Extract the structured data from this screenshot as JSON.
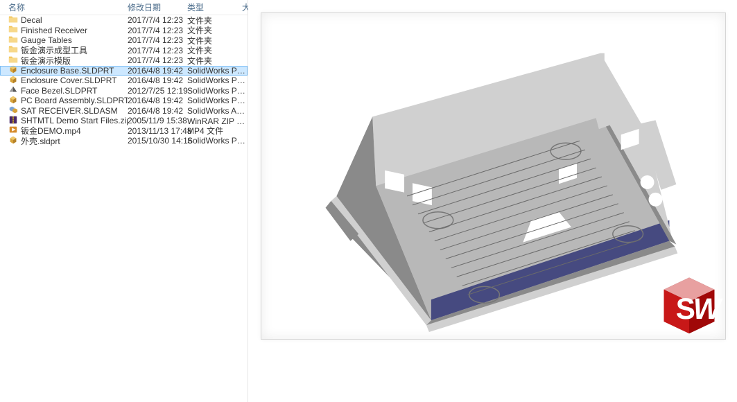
{
  "headers": {
    "name": "名称",
    "date": "修改日期",
    "type": "类型",
    "extra": "大"
  },
  "files": [
    {
      "icon": "folder",
      "name": "Decal",
      "date": "2017/7/4 12:23",
      "type": "文件夹",
      "selected": false
    },
    {
      "icon": "folder",
      "name": "Finished Receiver",
      "date": "2017/7/4 12:23",
      "type": "文件夹",
      "selected": false
    },
    {
      "icon": "folder",
      "name": "Gauge Tables",
      "date": "2017/7/4 12:23",
      "type": "文件夹",
      "selected": false
    },
    {
      "icon": "folder",
      "name": "钣金演示成型工具",
      "date": "2017/7/4 12:23",
      "type": "文件夹",
      "selected": false
    },
    {
      "icon": "folder",
      "name": "钣金演示模版",
      "date": "2017/7/4 12:23",
      "type": "文件夹",
      "selected": false
    },
    {
      "icon": "sldprt",
      "name": "Enclosure Base.SLDPRT",
      "date": "2016/4/8 19:42",
      "type": "SolidWorks Part...",
      "selected": true
    },
    {
      "icon": "sldprt",
      "name": "Enclosure Cover.SLDPRT",
      "date": "2016/4/8 19:42",
      "type": "SolidWorks Part...",
      "selected": false
    },
    {
      "icon": "sldprt-alt",
      "name": "Face Bezel.SLDPRT",
      "date": "2012/7/25 12:19",
      "type": "SolidWorks Part...",
      "selected": false
    },
    {
      "icon": "sldprt",
      "name": "PC Board Assembly.SLDPRT",
      "date": "2016/4/8 19:42",
      "type": "SolidWorks Part...",
      "selected": false
    },
    {
      "icon": "sldasm",
      "name": "SAT RECEIVER.SLDASM",
      "date": "2016/4/8 19:42",
      "type": "SolidWorks Ass...",
      "selected": false
    },
    {
      "icon": "zip",
      "name": "SHTMTL Demo Start Files.zip",
      "date": "2005/11/9 15:38",
      "type": "WinRAR ZIP 压缩...",
      "selected": false
    },
    {
      "icon": "mp4",
      "name": "钣金DEMO.mp4",
      "date": "2013/11/13 17:48",
      "type": "MP4 文件",
      "selected": false
    },
    {
      "icon": "sldprt",
      "name": "外壳.sldprt",
      "date": "2015/10/30 14:16",
      "type": "SolidWorks Part...",
      "selected": false
    }
  ],
  "logo": {
    "text_s": "S",
    "text_w": "W"
  }
}
